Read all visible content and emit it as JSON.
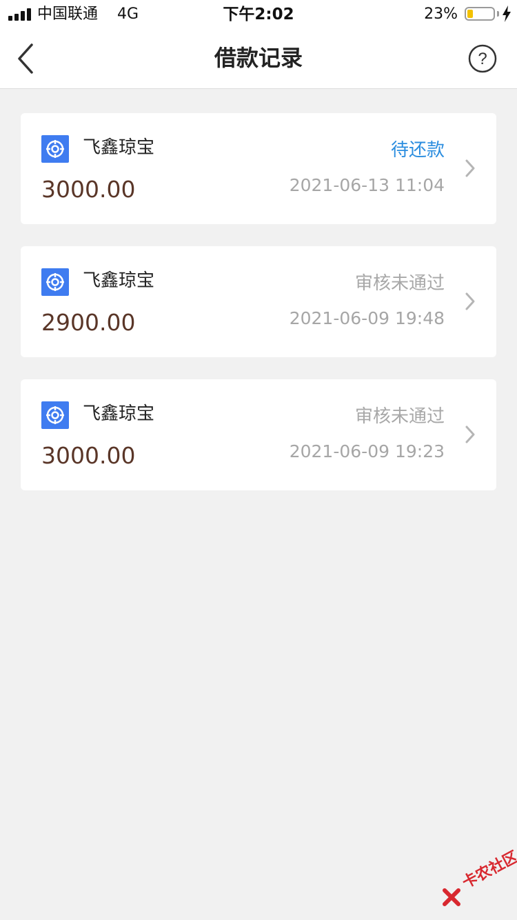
{
  "status_bar": {
    "carrier": "中国联通",
    "network": "4G",
    "time": "下午2:02",
    "battery_percent": "23%",
    "battery_level": 0.23,
    "icons": [
      "signal-icon",
      "battery-icon",
      "charging-icon"
    ]
  },
  "nav": {
    "title": "借款记录",
    "back_icon": "chevron-left-icon",
    "help_icon": "help-circle-icon"
  },
  "records": [
    {
      "app_name": "飞鑫琼宝",
      "amount": "3000.00",
      "status": "待还款",
      "datetime": "2021-06-13 11:04"
    },
    {
      "app_name": "飞鑫琼宝",
      "amount": "2900.00",
      "status": "审核未通过",
      "datetime": "2021-06-09 19:48"
    },
    {
      "app_name": "飞鑫琼宝",
      "amount": "3000.00",
      "status": "审核未通过",
      "datetime": "2021-06-09 19:23"
    }
  ],
  "watermark": {
    "text": "卡农社区"
  },
  "colors": {
    "amount": "#5a3628",
    "status_pending": "#2b8ddf",
    "status_rejected": "#a8a8a8",
    "logo": "#3f7cf0",
    "background": "#f1f1f1"
  }
}
